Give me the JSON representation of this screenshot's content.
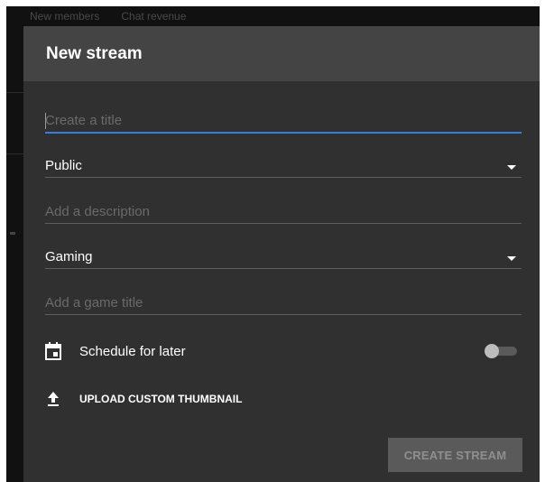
{
  "background": {
    "tabs": [
      "New members",
      "Chat revenue"
    ]
  },
  "dialog": {
    "title": "New stream",
    "title_field": {
      "placeholder": "Create a title",
      "value": ""
    },
    "visibility_select": {
      "value": "Public"
    },
    "description_field": {
      "placeholder": "Add a description",
      "value": ""
    },
    "category_select": {
      "value": "Gaming"
    },
    "game_title_field": {
      "placeholder": "Add a game title",
      "value": ""
    },
    "schedule": {
      "label": "Schedule for later",
      "icon": "calendar-icon",
      "enabled": false
    },
    "upload": {
      "label": "UPLOAD CUSTOM THUMBNAIL",
      "icon": "upload-icon"
    },
    "create_button": {
      "label": "CREATE STREAM",
      "disabled": true
    }
  },
  "colors": {
    "accent": "#3b7bd4",
    "dialog_bg": "#303030",
    "header_bg": "#444444",
    "button_disabled_bg": "#5a5a5a"
  }
}
